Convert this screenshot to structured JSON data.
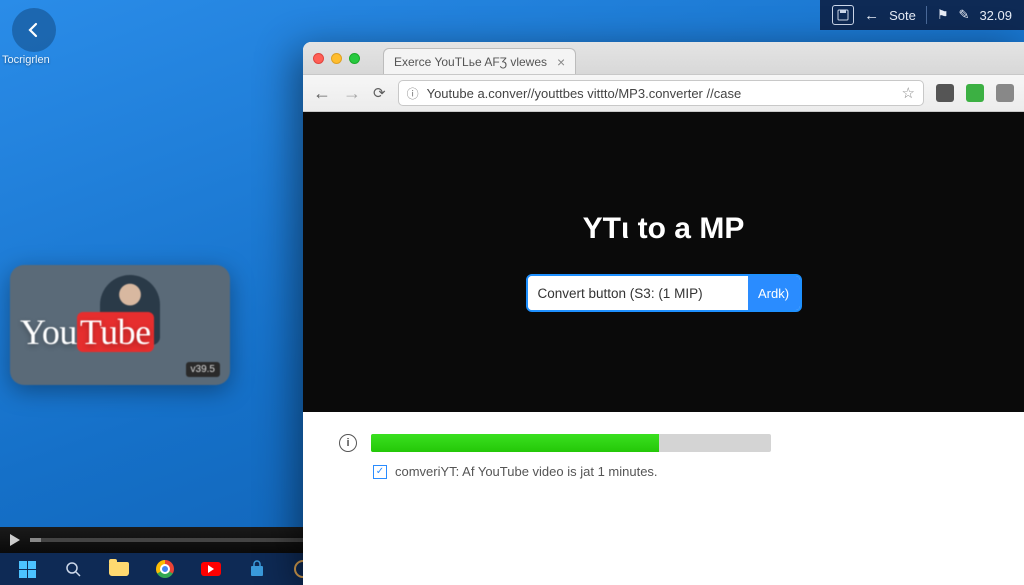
{
  "desktop": {
    "icon_label": "Tocrigrlen"
  },
  "tray": {
    "sote_label": "Sote",
    "clock": "32.09"
  },
  "yt_card": {
    "logo_you": "You",
    "logo_tube": "Tube",
    "badge": "v39.5"
  },
  "browser": {
    "tab_title": "Exerce YouTLьe AFƷ vlewes",
    "url": "Youtube a.conver//youttbes vittto/MP3.converter //case"
  },
  "page": {
    "hero_title": "YTι to a MP",
    "input_value": "Convert button (S3: (1 MIP)",
    "convert_label": "Ardk)",
    "progress_pct": 72,
    "status_text": "comveriYT: Af YouTube video is jat 1 minutes."
  }
}
